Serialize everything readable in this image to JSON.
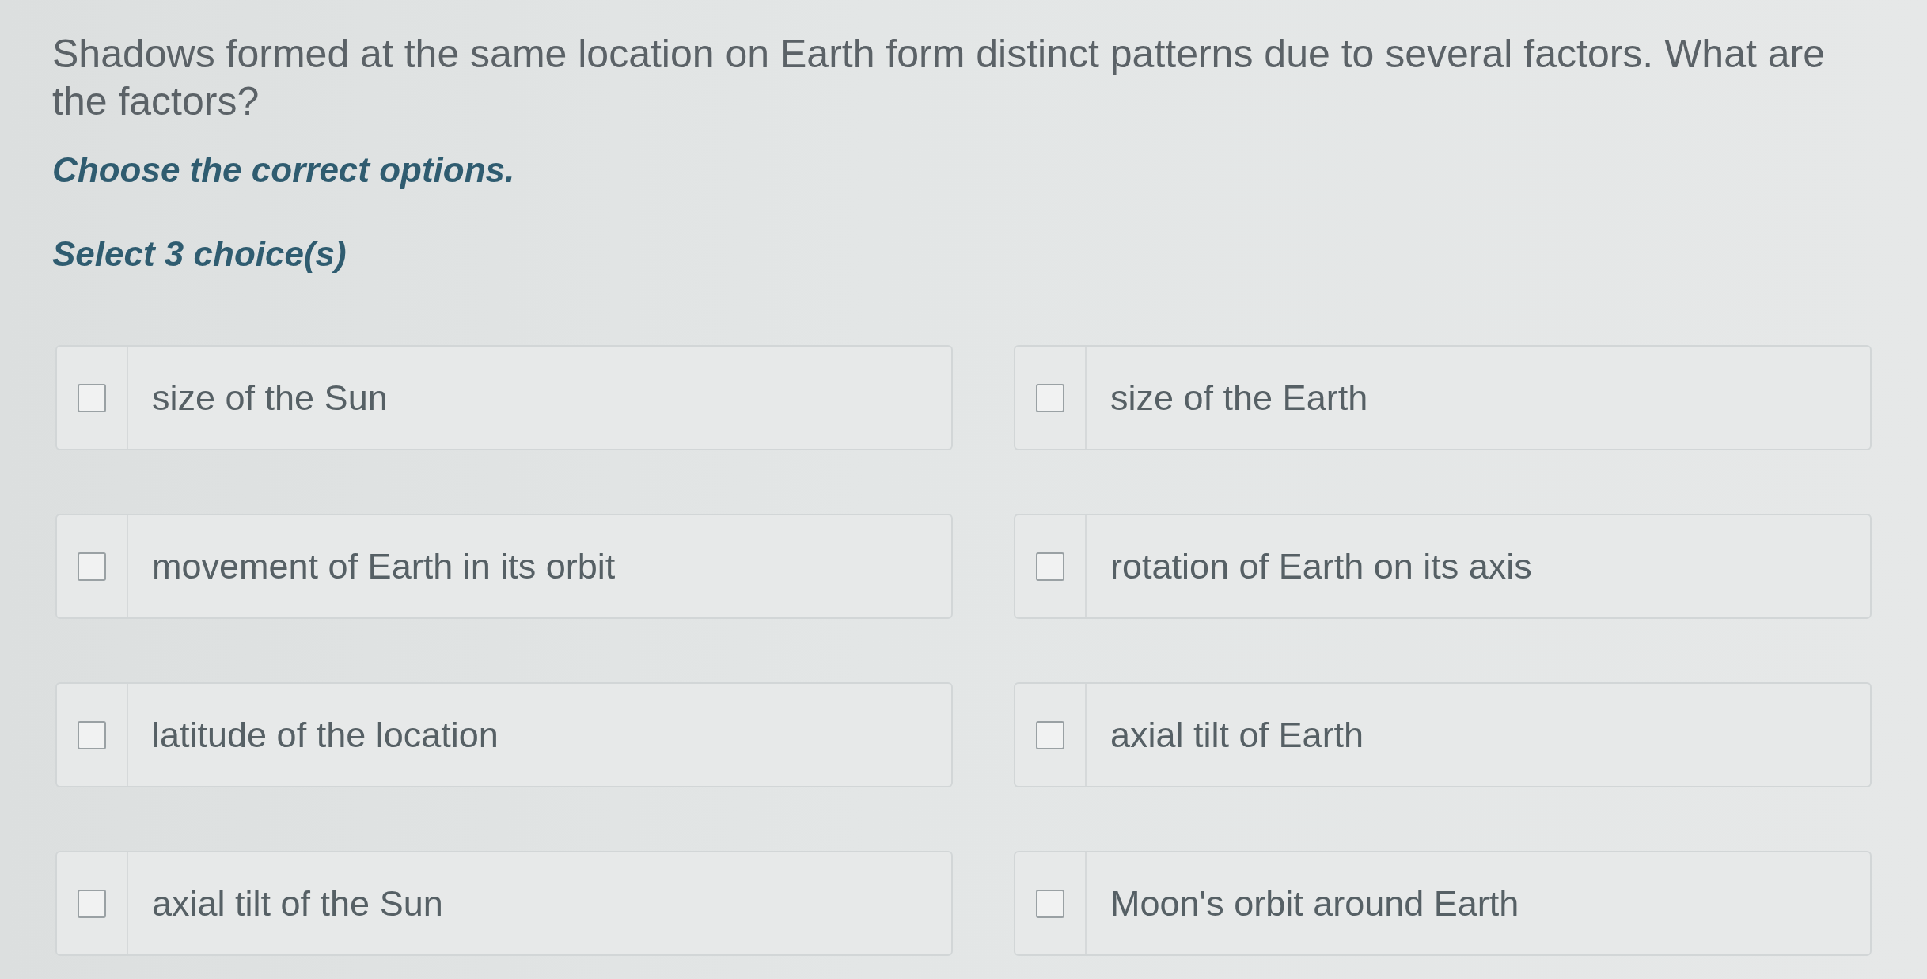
{
  "question": {
    "text": "Shadows formed at the same location on Earth form distinct patterns due to several factors. What are the factors?",
    "instruction": "Choose the correct options.",
    "selection_hint": "Select 3 choice(s)"
  },
  "options": [
    {
      "label": "size of the Sun",
      "checked": false
    },
    {
      "label": "size of the Earth",
      "checked": false
    },
    {
      "label": "movement of Earth in its orbit",
      "checked": false
    },
    {
      "label": "rotation of Earth on its axis",
      "checked": false
    },
    {
      "label": "latitude of the location",
      "checked": false
    },
    {
      "label": "axial tilt of Earth",
      "checked": false
    },
    {
      "label": "axial tilt of the Sun",
      "checked": false
    },
    {
      "label": "Moon's orbit around Earth",
      "checked": false
    }
  ]
}
